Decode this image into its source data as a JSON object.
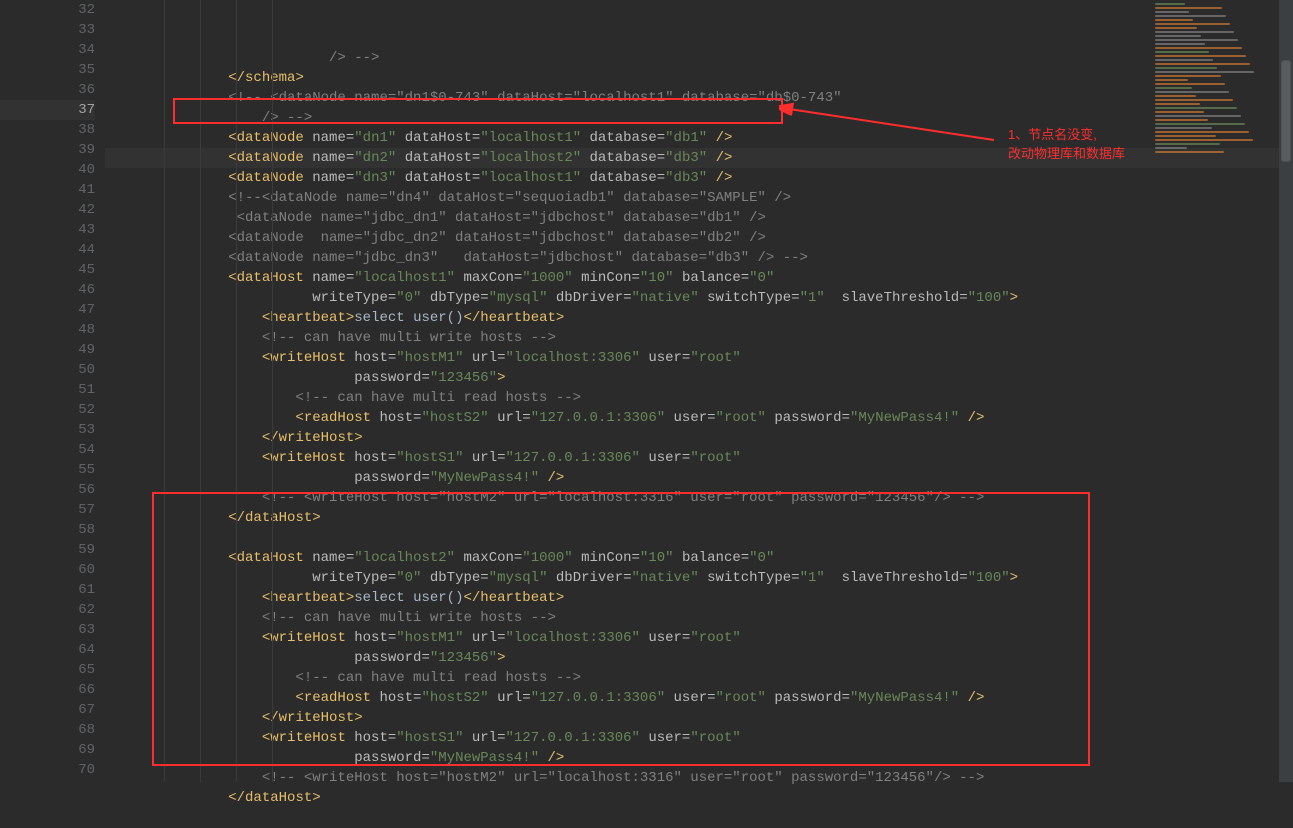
{
  "annotation": {
    "line1": "1、节点名没变,",
    "line2": "改动物理库和数据库"
  },
  "lines": [
    {
      "n": 32,
      "indent": 5,
      "segs": [
        {
          "t": "/> -->",
          "c": "c-comm"
        }
      ]
    },
    {
      "n": 33,
      "indent": 2,
      "segs": [
        {
          "t": "</",
          "c": "c-brkt"
        },
        {
          "t": "schema",
          "c": "c-tagname"
        },
        {
          "t": ">",
          "c": "c-brkt"
        }
      ]
    },
    {
      "n": 34,
      "indent": 2,
      "segs": [
        {
          "t": "<!-- <dataNode name=\"dn1$0-743\" dataHost=\"localhost1\" database=\"db$0-743\"",
          "c": "c-comm"
        }
      ]
    },
    {
      "n": 35,
      "indent": 3,
      "segs": [
        {
          "t": "/> -->",
          "c": "c-comm"
        }
      ]
    },
    {
      "n": 36,
      "indent": 2,
      "segs": [
        {
          "t": "<",
          "c": "c-brkt"
        },
        {
          "t": "dataNode ",
          "c": "c-tagname"
        },
        {
          "t": "name=",
          "c": "c-attr"
        },
        {
          "t": "\"dn1\" ",
          "c": "c-str"
        },
        {
          "t": "dataHost=",
          "c": "c-attr"
        },
        {
          "t": "\"localhost1\" ",
          "c": "c-str"
        },
        {
          "t": "database=",
          "c": "c-attr"
        },
        {
          "t": "\"db1\" ",
          "c": "c-str"
        },
        {
          "t": "/>",
          "c": "c-brkt"
        }
      ]
    },
    {
      "n": 37,
      "current": true,
      "indent": 2,
      "segs": [
        {
          "t": "<",
          "c": "c-brkt"
        },
        {
          "t": "dataNode ",
          "c": "c-tagname"
        },
        {
          "t": "name=",
          "c": "c-attr"
        },
        {
          "t": "\"dn2\" ",
          "c": "c-str"
        },
        {
          "t": "dataHost=",
          "c": "c-attr"
        },
        {
          "t": "\"localhost2\" ",
          "c": "c-str"
        },
        {
          "t": "database=",
          "c": "c-attr"
        },
        {
          "t": "\"db3\" ",
          "c": "c-str"
        },
        {
          "t": "/>",
          "c": "c-brkt"
        }
      ]
    },
    {
      "n": 38,
      "indent": 2,
      "segs": [
        {
          "t": "<",
          "c": "c-brkt"
        },
        {
          "t": "dataNode ",
          "c": "c-tagname"
        },
        {
          "t": "name=",
          "c": "c-attr"
        },
        {
          "t": "\"dn3\" ",
          "c": "c-str"
        },
        {
          "t": "dataHost=",
          "c": "c-attr"
        },
        {
          "t": "\"localhost1\" ",
          "c": "c-str"
        },
        {
          "t": "database=",
          "c": "c-attr"
        },
        {
          "t": "\"db3\" ",
          "c": "c-str"
        },
        {
          "t": "/>",
          "c": "c-brkt"
        }
      ]
    },
    {
      "n": 39,
      "indent": 2,
      "segs": [
        {
          "t": "<!--<dataNode name=\"dn4\" dataHost=\"sequoiadb1\" database=\"SAMPLE\" />",
          "c": "c-comm"
        }
      ]
    },
    {
      "n": 40,
      "indent": 2,
      "segs": [
        {
          "t": " <dataNode name=\"jdbc_dn1\" dataHost=\"jdbchost\" database=\"db1\" />",
          "c": "c-comm"
        }
      ]
    },
    {
      "n": 41,
      "indent": 2,
      "segs": [
        {
          "t": "<dataNode  name=\"jdbc_dn2\" dataHost=\"jdbchost\" database=\"db2\" />",
          "c": "c-comm"
        }
      ]
    },
    {
      "n": 42,
      "indent": 2,
      "segs": [
        {
          "t": "<dataNode name=\"jdbc_dn3\"   dataHost=\"jdbchost\" database=\"db3\" /> -->",
          "c": "c-comm"
        }
      ]
    },
    {
      "n": 43,
      "indent": 2,
      "segs": [
        {
          "t": "<",
          "c": "c-brkt"
        },
        {
          "t": "dataHost ",
          "c": "c-tagname"
        },
        {
          "t": "name=",
          "c": "c-attr"
        },
        {
          "t": "\"localhost1\" ",
          "c": "c-str"
        },
        {
          "t": "maxCon=",
          "c": "c-attr"
        },
        {
          "t": "\"1000\" ",
          "c": "c-str"
        },
        {
          "t": "minCon=",
          "c": "c-attr"
        },
        {
          "t": "\"10\" ",
          "c": "c-str"
        },
        {
          "t": "balance=",
          "c": "c-attr"
        },
        {
          "t": "\"0\"",
          "c": "c-str"
        }
      ]
    },
    {
      "n": 44,
      "indent": 4,
      "segs": [
        {
          "t": "  ",
          "c": "c-attr"
        },
        {
          "t": "writeType=",
          "c": "c-attr"
        },
        {
          "t": "\"0\" ",
          "c": "c-str"
        },
        {
          "t": "dbType=",
          "c": "c-attr"
        },
        {
          "t": "\"mysql\" ",
          "c": "c-str"
        },
        {
          "t": "dbDriver=",
          "c": "c-attr"
        },
        {
          "t": "\"native\" ",
          "c": "c-str"
        },
        {
          "t": "switchType=",
          "c": "c-attr"
        },
        {
          "t": "\"1\"  ",
          "c": "c-str"
        },
        {
          "t": "slaveThreshold=",
          "c": "c-attr"
        },
        {
          "t": "\"100\"",
          "c": "c-str"
        },
        {
          "t": ">",
          "c": "c-brkt"
        }
      ]
    },
    {
      "n": 45,
      "indent": 3,
      "segs": [
        {
          "t": "<",
          "c": "c-brkt"
        },
        {
          "t": "heartbeat",
          "c": "c-tagname"
        },
        {
          "t": ">",
          "c": "c-brkt"
        },
        {
          "t": "select user()",
          "c": "c-punct"
        },
        {
          "t": "</",
          "c": "c-brkt"
        },
        {
          "t": "heartbeat",
          "c": "c-tagname"
        },
        {
          "t": ">",
          "c": "c-brkt"
        }
      ]
    },
    {
      "n": 46,
      "indent": 3,
      "segs": [
        {
          "t": "<!-- can have multi write hosts -->",
          "c": "c-comm"
        }
      ]
    },
    {
      "n": 47,
      "indent": 3,
      "segs": [
        {
          "t": "<",
          "c": "c-brkt"
        },
        {
          "t": "writeHost ",
          "c": "c-tagname"
        },
        {
          "t": "host=",
          "c": "c-attr"
        },
        {
          "t": "\"hostM1\" ",
          "c": "c-str"
        },
        {
          "t": "url=",
          "c": "c-attr"
        },
        {
          "t": "\"localhost:3306\" ",
          "c": "c-str"
        },
        {
          "t": "user=",
          "c": "c-attr"
        },
        {
          "t": "\"root\"",
          "c": "c-str"
        }
      ]
    },
    {
      "n": 48,
      "indent": 5,
      "segs": [
        {
          "t": "   ",
          "c": "c-attr"
        },
        {
          "t": "password=",
          "c": "c-attr"
        },
        {
          "t": "\"123456\"",
          "c": "c-str"
        },
        {
          "t": ">",
          "c": "c-brkt"
        }
      ]
    },
    {
      "n": 49,
      "indent": 4,
      "segs": [
        {
          "t": "<!-- can have multi read hosts -->",
          "c": "c-comm"
        }
      ]
    },
    {
      "n": 50,
      "indent": 4,
      "segs": [
        {
          "t": "<",
          "c": "c-brkt"
        },
        {
          "t": "readHost ",
          "c": "c-tagname"
        },
        {
          "t": "host=",
          "c": "c-attr"
        },
        {
          "t": "\"hostS2\" ",
          "c": "c-str"
        },
        {
          "t": "url=",
          "c": "c-attr"
        },
        {
          "t": "\"127.0.0.1:3306\" ",
          "c": "c-str"
        },
        {
          "t": "user=",
          "c": "c-attr"
        },
        {
          "t": "\"root\" ",
          "c": "c-str"
        },
        {
          "t": "password=",
          "c": "c-attr"
        },
        {
          "t": "\"MyNewPass4!\" ",
          "c": "c-str"
        },
        {
          "t": "/>",
          "c": "c-brkt"
        }
      ]
    },
    {
      "n": 51,
      "indent": 3,
      "segs": [
        {
          "t": "</",
          "c": "c-brkt"
        },
        {
          "t": "writeHost",
          "c": "c-tagname"
        },
        {
          "t": ">",
          "c": "c-brkt"
        }
      ]
    },
    {
      "n": 52,
      "indent": 3,
      "segs": [
        {
          "t": "<",
          "c": "c-brkt"
        },
        {
          "t": "writeHost ",
          "c": "c-tagname"
        },
        {
          "t": "host=",
          "c": "c-attr"
        },
        {
          "t": "\"hostS1\" ",
          "c": "c-str"
        },
        {
          "t": "url=",
          "c": "c-attr"
        },
        {
          "t": "\"127.0.0.1:3306\" ",
          "c": "c-str"
        },
        {
          "t": "user=",
          "c": "c-attr"
        },
        {
          "t": "\"root\"",
          "c": "c-str"
        }
      ]
    },
    {
      "n": 53,
      "indent": 5,
      "segs": [
        {
          "t": "   ",
          "c": "c-attr"
        },
        {
          "t": "password=",
          "c": "c-attr"
        },
        {
          "t": "\"MyNewPass4!\" ",
          "c": "c-str"
        },
        {
          "t": "/>",
          "c": "c-brkt"
        }
      ]
    },
    {
      "n": 54,
      "indent": 3,
      "segs": [
        {
          "t": "<!-- <writeHost host=\"hostM2\" url=\"localhost:3316\" user=\"root\" password=\"123456\"/> -->",
          "c": "c-comm"
        }
      ]
    },
    {
      "n": 55,
      "indent": 2,
      "segs": [
        {
          "t": "</",
          "c": "c-brkt"
        },
        {
          "t": "dataHost",
          "c": "c-tagname"
        },
        {
          "t": ">",
          "c": "c-brkt"
        }
      ]
    },
    {
      "n": 56,
      "indent": 0,
      "segs": []
    },
    {
      "n": 57,
      "indent": 2,
      "segs": [
        {
          "t": "<",
          "c": "c-brkt"
        },
        {
          "t": "dataHost ",
          "c": "c-tagname"
        },
        {
          "t": "name=",
          "c": "c-attr"
        },
        {
          "t": "\"localhost2\" ",
          "c": "c-str"
        },
        {
          "t": "maxCon=",
          "c": "c-attr"
        },
        {
          "t": "\"1000\" ",
          "c": "c-str"
        },
        {
          "t": "minCon=",
          "c": "c-attr"
        },
        {
          "t": "\"10\" ",
          "c": "c-str"
        },
        {
          "t": "balance=",
          "c": "c-attr"
        },
        {
          "t": "\"0\"",
          "c": "c-str"
        }
      ]
    },
    {
      "n": 58,
      "indent": 4,
      "segs": [
        {
          "t": "  ",
          "c": "c-attr"
        },
        {
          "t": "writeType=",
          "c": "c-attr"
        },
        {
          "t": "\"0\" ",
          "c": "c-str"
        },
        {
          "t": "dbType=",
          "c": "c-attr"
        },
        {
          "t": "\"mysql\" ",
          "c": "c-str"
        },
        {
          "t": "dbDriver=",
          "c": "c-attr"
        },
        {
          "t": "\"native\" ",
          "c": "c-str"
        },
        {
          "t": "switchType=",
          "c": "c-attr"
        },
        {
          "t": "\"1\"  ",
          "c": "c-str"
        },
        {
          "t": "slaveThreshold=",
          "c": "c-attr"
        },
        {
          "t": "\"100\"",
          "c": "c-str"
        },
        {
          "t": ">",
          "c": "c-brkt"
        }
      ]
    },
    {
      "n": 59,
      "indent": 3,
      "segs": [
        {
          "t": "<",
          "c": "c-brkt"
        },
        {
          "t": "heartbeat",
          "c": "c-tagname"
        },
        {
          "t": ">",
          "c": "c-brkt"
        },
        {
          "t": "select user()",
          "c": "c-punct"
        },
        {
          "t": "</",
          "c": "c-brkt"
        },
        {
          "t": "heartbeat",
          "c": "c-tagname"
        },
        {
          "t": ">",
          "c": "c-brkt"
        }
      ]
    },
    {
      "n": 60,
      "indent": 3,
      "segs": [
        {
          "t": "<!-- can have multi write hosts -->",
          "c": "c-comm"
        }
      ]
    },
    {
      "n": 61,
      "indent": 3,
      "segs": [
        {
          "t": "<",
          "c": "c-brkt"
        },
        {
          "t": "writeHost ",
          "c": "c-tagname"
        },
        {
          "t": "host=",
          "c": "c-attr"
        },
        {
          "t": "\"hostM1\" ",
          "c": "c-str"
        },
        {
          "t": "url=",
          "c": "c-attr"
        },
        {
          "t": "\"localhost:3306\" ",
          "c": "c-str"
        },
        {
          "t": "user=",
          "c": "c-attr"
        },
        {
          "t": "\"root\"",
          "c": "c-str"
        }
      ]
    },
    {
      "n": 62,
      "indent": 5,
      "segs": [
        {
          "t": "   ",
          "c": "c-attr"
        },
        {
          "t": "password=",
          "c": "c-attr"
        },
        {
          "t": "\"123456\"",
          "c": "c-str"
        },
        {
          "t": ">",
          "c": "c-brkt"
        }
      ]
    },
    {
      "n": 63,
      "indent": 4,
      "segs": [
        {
          "t": "<!-- can have multi read hosts -->",
          "c": "c-comm"
        }
      ]
    },
    {
      "n": 64,
      "indent": 4,
      "segs": [
        {
          "t": "<",
          "c": "c-brkt"
        },
        {
          "t": "readHost ",
          "c": "c-tagname"
        },
        {
          "t": "host=",
          "c": "c-attr"
        },
        {
          "t": "\"hostS2\" ",
          "c": "c-str"
        },
        {
          "t": "url=",
          "c": "c-attr"
        },
        {
          "t": "\"127.0.0.1:3306\" ",
          "c": "c-str"
        },
        {
          "t": "user=",
          "c": "c-attr"
        },
        {
          "t": "\"root\" ",
          "c": "c-str"
        },
        {
          "t": "password=",
          "c": "c-attr"
        },
        {
          "t": "\"MyNewPass4!\" ",
          "c": "c-str"
        },
        {
          "t": "/>",
          "c": "c-brkt"
        }
      ]
    },
    {
      "n": 65,
      "indent": 3,
      "segs": [
        {
          "t": "</",
          "c": "c-brkt"
        },
        {
          "t": "writeHost",
          "c": "c-tagname"
        },
        {
          "t": ">",
          "c": "c-brkt"
        }
      ]
    },
    {
      "n": 66,
      "indent": 3,
      "segs": [
        {
          "t": "<",
          "c": "c-brkt"
        },
        {
          "t": "writeHost ",
          "c": "c-tagname"
        },
        {
          "t": "host=",
          "c": "c-attr"
        },
        {
          "t": "\"hostS1\" ",
          "c": "c-str"
        },
        {
          "t": "url=",
          "c": "c-attr"
        },
        {
          "t": "\"127.0.0.1:3306\" ",
          "c": "c-str"
        },
        {
          "t": "user=",
          "c": "c-attr"
        },
        {
          "t": "\"root\"",
          "c": "c-str"
        }
      ]
    },
    {
      "n": 67,
      "indent": 5,
      "segs": [
        {
          "t": "   ",
          "c": "c-attr"
        },
        {
          "t": "password=",
          "c": "c-attr"
        },
        {
          "t": "\"MyNewPass4!\" ",
          "c": "c-str"
        },
        {
          "t": "/>",
          "c": "c-brkt"
        }
      ]
    },
    {
      "n": 68,
      "indent": 3,
      "segs": [
        {
          "t": "<!-- <writeHost host=\"hostM2\" url=\"localhost:3316\" user=\"root\" password=\"123456\"/> -->",
          "c": "c-comm"
        }
      ]
    },
    {
      "n": 69,
      "indent": 2,
      "segs": [
        {
          "t": "</",
          "c": "c-brkt"
        },
        {
          "t": "dataHost",
          "c": "c-tagname"
        },
        {
          "t": ">",
          "c": "c-brkt"
        }
      ]
    },
    {
      "n": 70,
      "indent": 0,
      "segs": []
    }
  ],
  "minimap_colors": [
    "#6a8759",
    "#cc7832",
    "#808080",
    "#808080",
    "#cc7832",
    "#cc7832",
    "#cc7832",
    "#808080",
    "#808080",
    "#808080",
    "#808080",
    "#cc7832",
    "#6a8759",
    "#cc7832",
    "#808080",
    "#cc7832",
    "#6a8759",
    "#808080",
    "#cc7832",
    "#cc7832",
    "#cc7832",
    "#6a8759",
    "#808080",
    "#cc7832",
    "#cc7832",
    "#cc7832",
    "#6a8759",
    "#cc7832",
    "#808080",
    "#cc7832",
    "#6a8759",
    "#808080",
    "#cc7832",
    "#cc7832",
    "#cc7832",
    "#6a8759",
    "#808080",
    "#cc7832"
  ]
}
